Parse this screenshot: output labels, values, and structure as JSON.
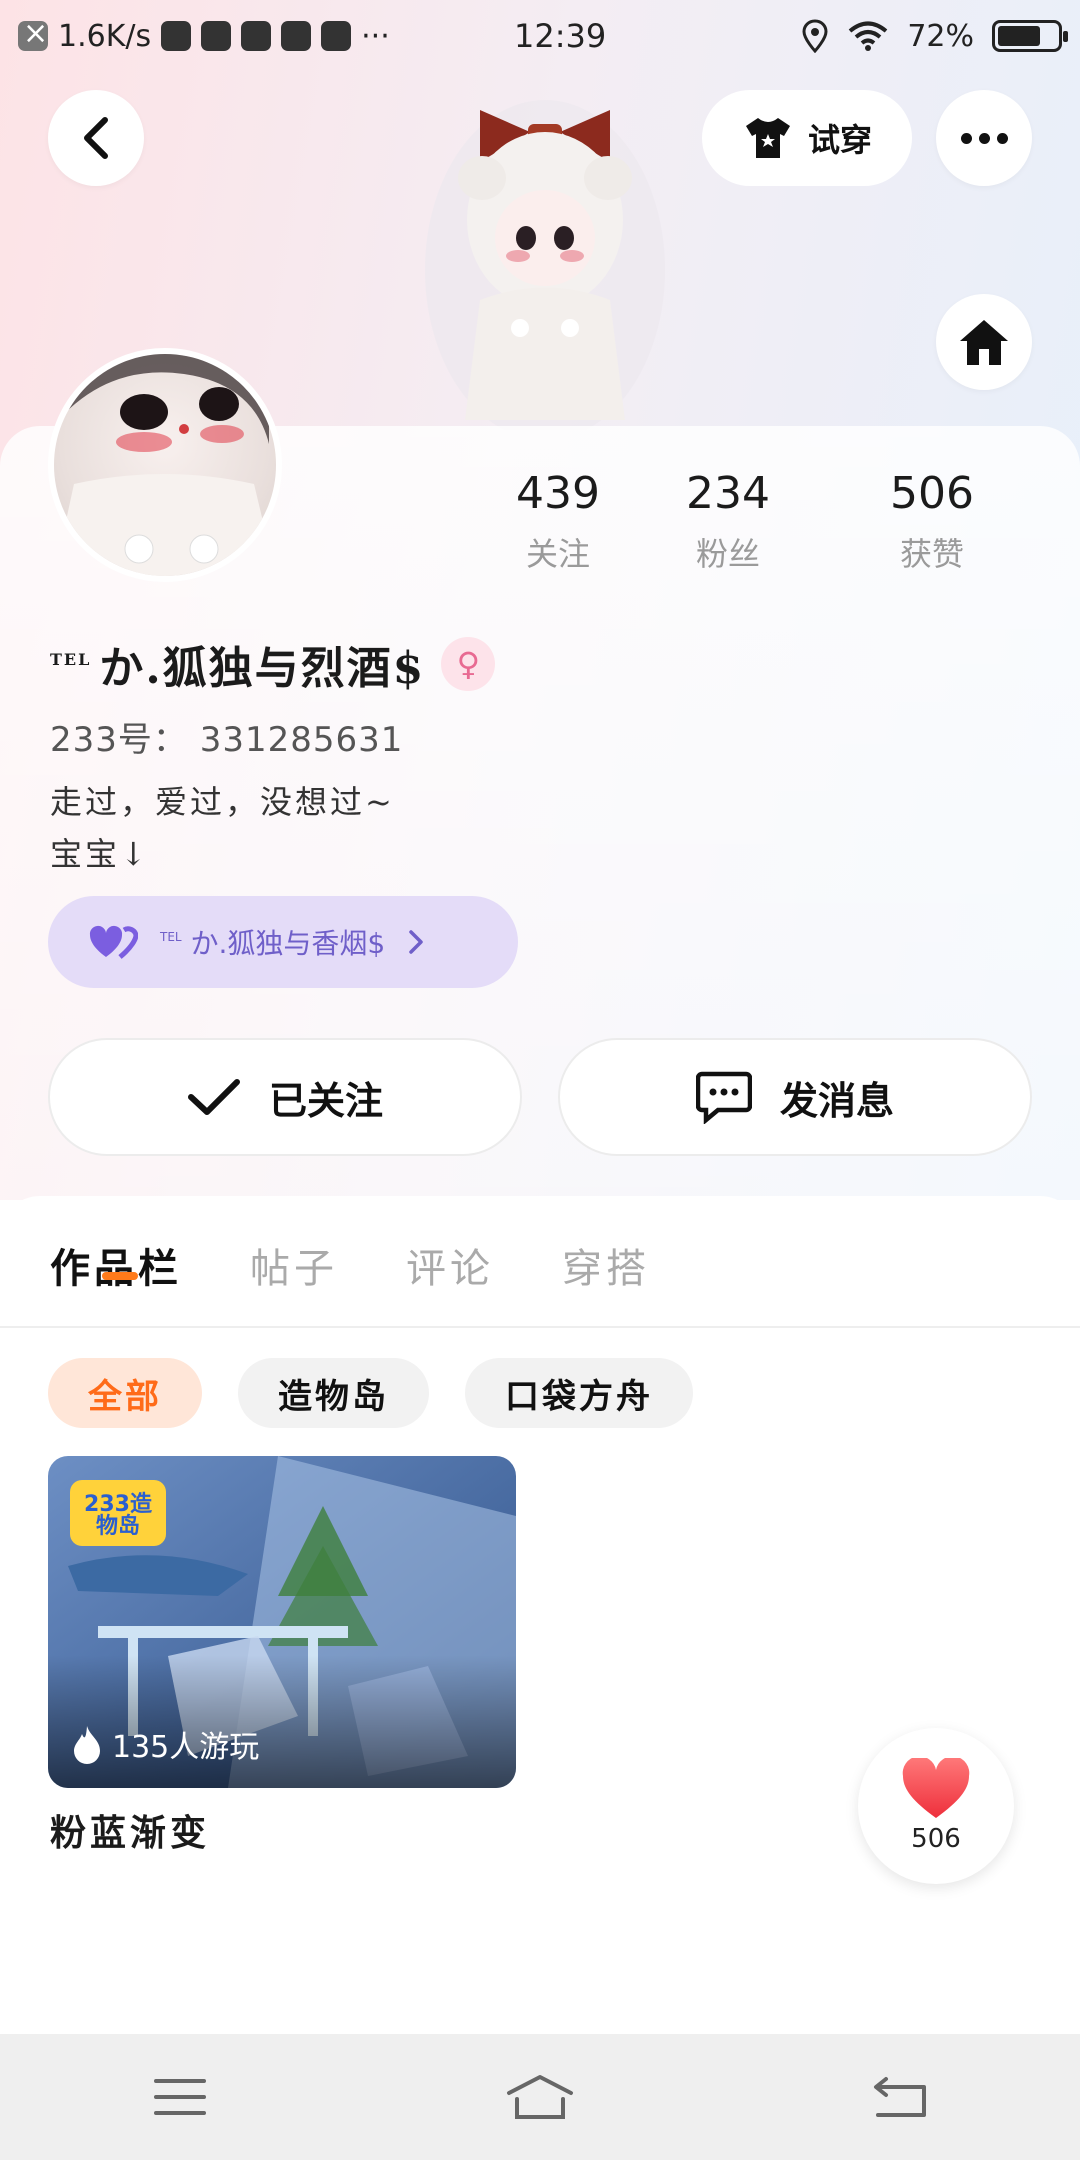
{
  "status_bar": {
    "net_speed": "1.6K/s",
    "time": "12:39",
    "battery": "72%",
    "battery_level": 0.72
  },
  "header": {
    "try_on_label": "试穿"
  },
  "profile": {
    "name_prefix": "TEL",
    "name": "か.狐独与烈酒$",
    "gender_icon": "female-icon",
    "uid": "233号： 331285631",
    "bio_line1": "走过，爱过，没想过~",
    "bio_line2": "宝宝↓",
    "cp_prefix": "TEL",
    "cp_name": "か.狐独与香烟$"
  },
  "stats": [
    {
      "value": "439",
      "label": "关注"
    },
    {
      "value": "234",
      "label": "粉丝"
    },
    {
      "value": "506",
      "label": "获赞"
    }
  ],
  "actions": {
    "follow_label": "已关注",
    "message_label": "发消息"
  },
  "tabs": [
    {
      "label": "作品栏",
      "active": true
    },
    {
      "label": "帖子",
      "active": false
    },
    {
      "label": "评论",
      "active": false
    },
    {
      "label": "穿搭",
      "active": false
    }
  ],
  "chips": [
    {
      "label": "全部",
      "active": true
    },
    {
      "label": "造物岛",
      "active": false
    },
    {
      "label": "口袋方舟",
      "active": false
    }
  ],
  "works": [
    {
      "title": "粉蓝渐变",
      "plays": "135人游玩",
      "badge": "233造物岛"
    }
  ],
  "like_fab": {
    "count": "506"
  },
  "colors": {
    "accent": "#ff7a1a",
    "cp_purple": "#6f5fc9",
    "female_pink": "#e86a92"
  }
}
